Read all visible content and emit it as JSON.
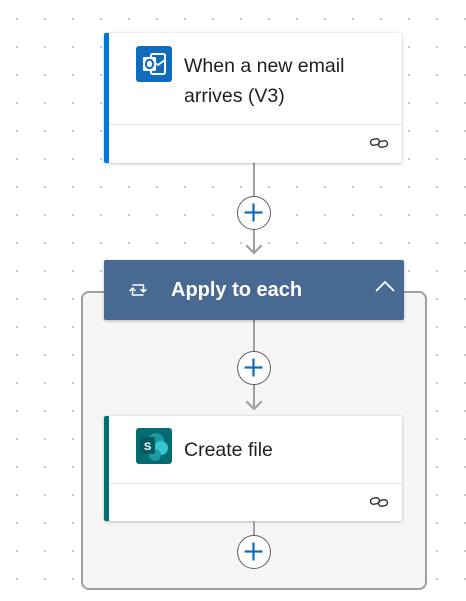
{
  "trigger": {
    "title": "When a new email arrives (V3)",
    "accent_color": "#0078d4",
    "icon": "outlook-icon",
    "icon_color": "#0f6cbd",
    "footer_icon": "link-icon"
  },
  "apply_to_each": {
    "title": "Apply to each",
    "header_color": "#486991",
    "icon": "loop-icon",
    "collapse_icon": "chevron-up-icon"
  },
  "create_file": {
    "title": "Create file",
    "accent_color": "#036c70",
    "icon": "sharepoint-icon",
    "icon_color": "#036c70",
    "footer_icon": "link-icon"
  },
  "add_step_icon": "plus-icon"
}
